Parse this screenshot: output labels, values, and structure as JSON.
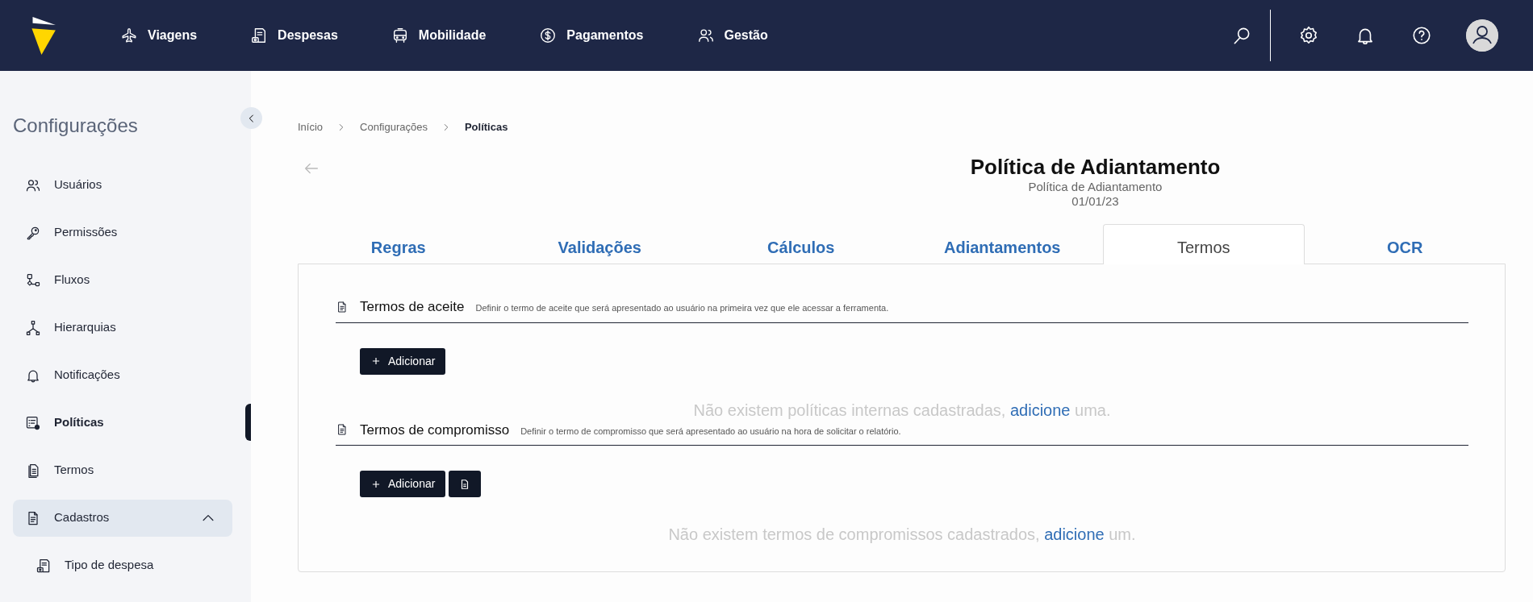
{
  "nav": {
    "items": [
      {
        "label": "Viagens"
      },
      {
        "label": "Despesas"
      },
      {
        "label": "Mobilidade"
      },
      {
        "label": "Pagamentos"
      },
      {
        "label": "Gestão"
      }
    ]
  },
  "sidebar": {
    "title": "Configurações",
    "items": [
      {
        "label": "Usuários",
        "selected": false
      },
      {
        "label": "Permissões",
        "selected": false
      },
      {
        "label": "Fluxos",
        "selected": false
      },
      {
        "label": "Hierarquias",
        "selected": false
      },
      {
        "label": "Notificações",
        "selected": false
      },
      {
        "label": "Políticas",
        "selected": true
      },
      {
        "label": "Termos",
        "selected": false
      },
      {
        "label": "Cadastros",
        "selected": false,
        "expanded": true,
        "children": [
          {
            "label": "Tipo de despesa",
            "selected": false
          }
        ]
      }
    ]
  },
  "breadcrumb": [
    {
      "label": "Início",
      "current": false
    },
    {
      "label": "Configurações",
      "current": false
    },
    {
      "label": "Políticas",
      "current": true
    }
  ],
  "header": {
    "title": "Política de Adiantamento",
    "subtitle": "Política de Adiantamento",
    "date": "01/01/23"
  },
  "tabs": [
    {
      "label": "Regras",
      "selected": false
    },
    {
      "label": "Validações",
      "selected": false
    },
    {
      "label": "Cálculos",
      "selected": false
    },
    {
      "label": "Adiantamentos",
      "selected": false
    },
    {
      "label": "Termos",
      "selected": true
    },
    {
      "label": "OCR",
      "selected": false
    }
  ],
  "sections": [
    {
      "title": "Termos de aceite",
      "description": "Definir o termo de aceite que será apresentado ao usuário na primeira vez que ele acessar a ferramenta.",
      "buttons": [
        {
          "kind": "add",
          "label": "Adicionar"
        }
      ],
      "empty_text": "Não existem políticas internas cadastradas,",
      "empty_link": "adicione",
      "empty_end": "uma."
    },
    {
      "title": "Termos de compromisso",
      "description": "Definir o termo de compromisso que será apresentado ao usuário na hora de solicitar o relatório.",
      "buttons": [
        {
          "kind": "add",
          "label": "Adicionar"
        },
        {
          "kind": "document"
        }
      ],
      "empty_text": "Não existem termos de compromissos cadastrados,",
      "empty_link": "adicione",
      "empty_end": "um."
    }
  ]
}
